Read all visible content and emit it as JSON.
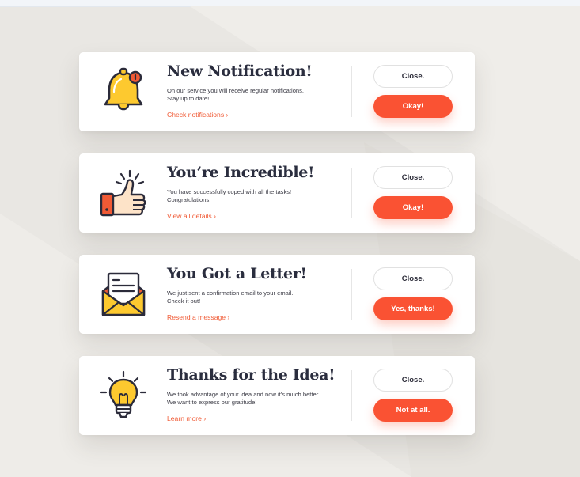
{
  "colors": {
    "accent": "#fa5233",
    "title": "#2a2d3e",
    "link": "#f05a35",
    "icon_yellow": "#fdc92f",
    "icon_outline": "#2b2b3a"
  },
  "cards": [
    {
      "icon": "bell-icon",
      "title": "New Notification!",
      "desc_line1": "On our service you will receive regular notifications.",
      "desc_line2": "Stay up to date!",
      "link": "Check notifications ›",
      "close": "Close.",
      "primary": "Okay!"
    },
    {
      "icon": "thumbs-up-icon",
      "title": "You’re Incredible!",
      "desc_line1": "You have successfully coped with all the tasks!",
      "desc_line2": "Congratulations.",
      "link": "View all details ›",
      "close": "Close.",
      "primary": "Okay!"
    },
    {
      "icon": "envelope-letter-icon",
      "title": "You Got a Letter!",
      "desc_line1": "We just sent a confirmation email to your email.",
      "desc_line2": "Check it out!",
      "link": "Resend a message ›",
      "close": "Close.",
      "primary": "Yes, thanks!"
    },
    {
      "icon": "lightbulb-icon",
      "title": "Thanks for the Idea!",
      "desc_line1": "We took advantage of your idea and now it's much better.",
      "desc_line2": "We want to express our gratitude!",
      "link": "Learn more ›",
      "close": "Close.",
      "primary": "Not at all."
    }
  ]
}
